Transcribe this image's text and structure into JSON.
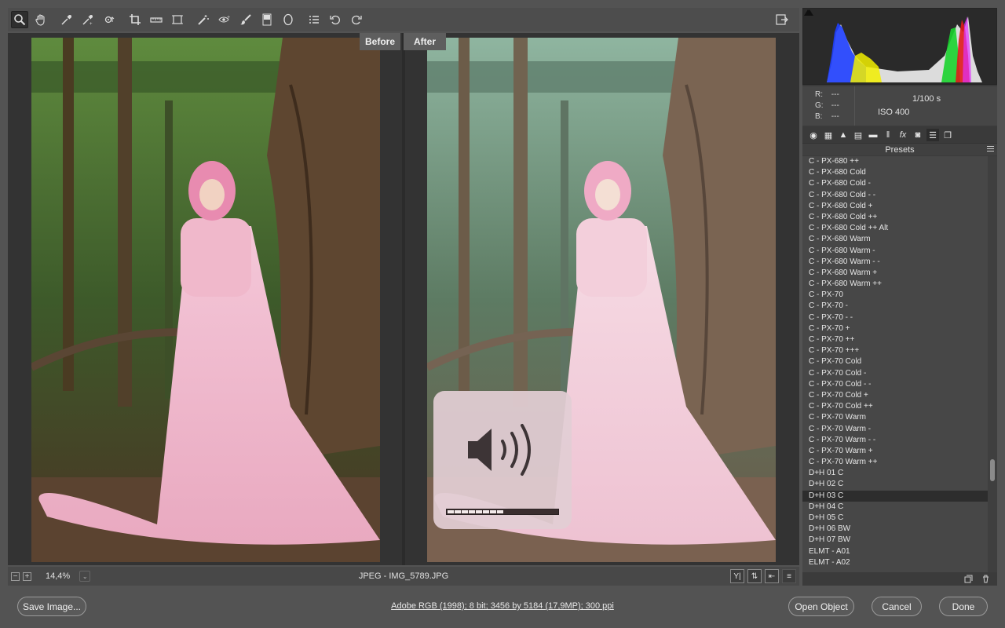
{
  "toolbar": {
    "tools": [
      "zoom-tool-icon",
      "hand-tool-icon",
      "white-balance-tool-icon",
      "color-sampler-tool-icon",
      "targeted-adjustment-tool-icon",
      "crop-tool-icon",
      "straighten-tool-icon",
      "transform-tool-icon",
      "spot-removal-tool-icon",
      "red-eye-tool-icon",
      "adjustment-brush-icon",
      "graduated-filter-icon",
      "radial-filter-icon",
      "preferences-list-icon",
      "rotate-left-icon",
      "rotate-right-icon"
    ]
  },
  "preview": {
    "before_label": "Before",
    "after_label": "After"
  },
  "hud": {
    "volume_level": 0.5
  },
  "status": {
    "zoom_out": "−",
    "zoom_in": "+",
    "zoom": "14,4%",
    "zoom_dropdown": "⌄",
    "filename": "JPEG  -  IMG_5789.JPG"
  },
  "readout": {
    "r_label": "R:",
    "r_value": "---",
    "g_label": "G:",
    "g_value": "---",
    "b_label": "B:",
    "b_value": "---",
    "shutter": "1/100 s",
    "iso": "ISO 400"
  },
  "panel": {
    "title": "Presets",
    "tab_fx": "fx"
  },
  "presets": [
    "C - PX-680 ++",
    "C - PX-680 Cold",
    "C - PX-680 Cold -",
    "C - PX-680 Cold - -",
    "C - PX-680 Cold +",
    "C - PX-680 Cold ++",
    "C - PX-680 Cold ++ Alt",
    "C - PX-680 Warm",
    "C - PX-680 Warm -",
    "C - PX-680 Warm - -",
    "C - PX-680 Warm +",
    "C - PX-680 Warm ++",
    "C - PX-70",
    "C - PX-70 -",
    "C - PX-70 - -",
    "C - PX-70 +",
    "C - PX-70 ++",
    "C - PX-70 +++",
    "C - PX-70 Cold",
    "C - PX-70 Cold -",
    "C - PX-70 Cold - -",
    "C - PX-70 Cold +",
    "C - PX-70 Cold ++",
    "C - PX-70 Warm",
    "C - PX-70 Warm -",
    "C - PX-70 Warm - -",
    "C - PX-70 Warm +",
    "C - PX-70 Warm ++",
    "D+H 01 C",
    "D+H 02 C",
    "D+H 03 C",
    "D+H 04 C",
    "D+H 05 C",
    "D+H 06 BW",
    "D+H 07 BW",
    "ELMT - A01",
    "ELMT - A02"
  ],
  "selected_preset": "D+H 03 C",
  "bottom": {
    "save_label": "Save Image...",
    "workflow_info": "Adobe RGB (1998); 8 bit; 3456 by 5184 (17,9MP); 300 ppi",
    "open_label": "Open Object",
    "cancel_label": "Cancel",
    "done_label": "Done"
  },
  "colors": {
    "background": "#535353",
    "panel": "#3b3b3b",
    "selection": "#2d2d2d"
  }
}
